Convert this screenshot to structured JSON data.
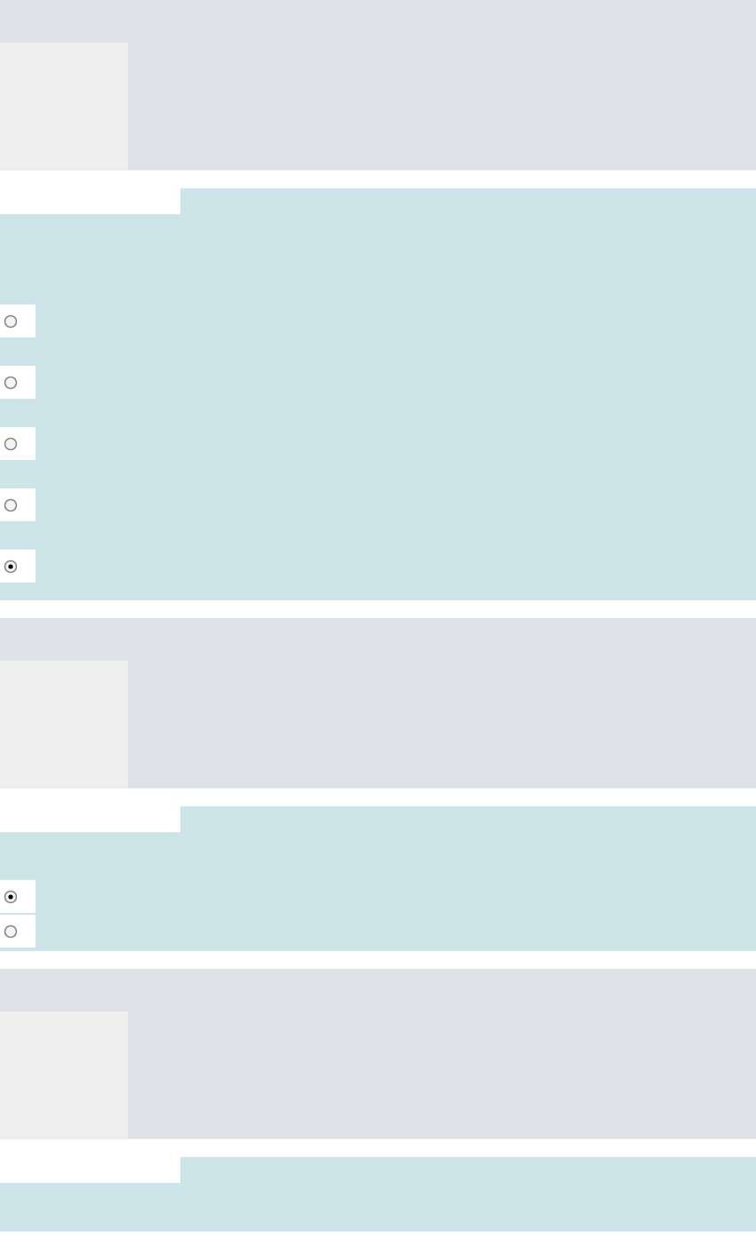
{
  "questions": [
    {
      "kind": "radio",
      "options": [
        {
          "selected": false
        },
        {
          "selected": false
        },
        {
          "selected": false
        },
        {
          "selected": false
        },
        {
          "selected": true
        }
      ]
    },
    {
      "kind": "radio",
      "options": [
        {
          "selected": true
        },
        {
          "selected": false
        }
      ]
    },
    {
      "kind": "radio"
    }
  ]
}
